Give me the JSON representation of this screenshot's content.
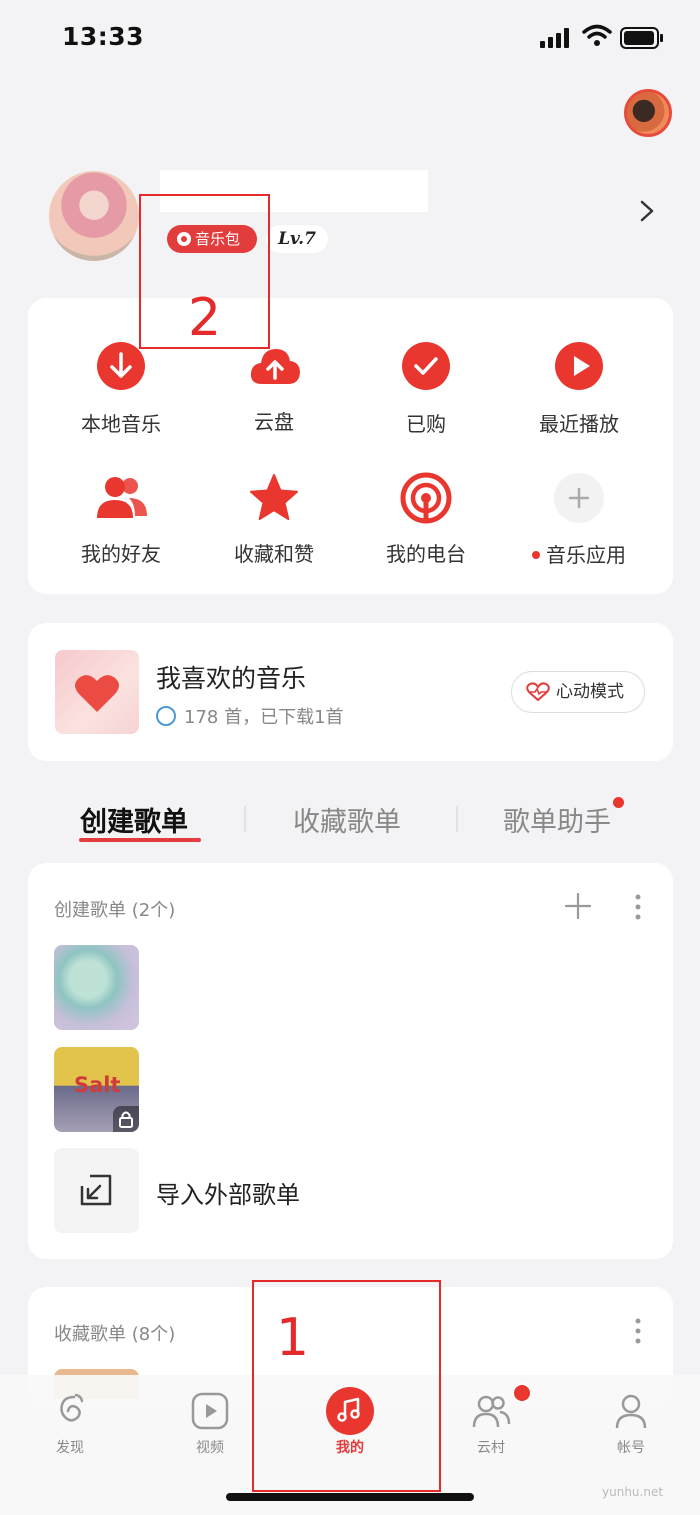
{
  "status_bar": {
    "time": "13:33"
  },
  "profile": {
    "badge_music": "音乐包",
    "level": "Lv.7"
  },
  "quick_grid": [
    {
      "label": "本地音乐",
      "icon": "download-icon"
    },
    {
      "label": "云盘",
      "icon": "cloud-upload-icon"
    },
    {
      "label": "已购",
      "icon": "check-icon"
    },
    {
      "label": "最近播放",
      "icon": "play-icon"
    },
    {
      "label": "我的好友",
      "icon": "friends-icon"
    },
    {
      "label": "收藏和赞",
      "icon": "star-icon"
    },
    {
      "label": "我的电台",
      "icon": "radio-icon"
    },
    {
      "label": "音乐应用",
      "icon": "plus-icon"
    }
  ],
  "favorites": {
    "title": "我喜欢的音乐",
    "subtitle": "178 首，已下载1首",
    "mode_button": "心动模式"
  },
  "tabs": [
    "创建歌单",
    "收藏歌单",
    "歌单助手"
  ],
  "created_playlists": {
    "header": "创建歌单 (2个)",
    "cover2_text": "Salt",
    "import_label": "导入外部歌单"
  },
  "collected_playlists": {
    "header": "收藏歌单 (8个)"
  },
  "tabbar": [
    {
      "label": "发现",
      "icon": "netease-logo-icon"
    },
    {
      "label": "视频",
      "icon": "video-play-icon"
    },
    {
      "label": "我的",
      "icon": "music-note-icon"
    },
    {
      "label": "云村",
      "icon": "community-icon"
    },
    {
      "label": "帐号",
      "icon": "account-icon"
    }
  ],
  "annotations": [
    "1",
    "2"
  ],
  "watermark": "yunhu.net",
  "colors": {
    "accent": "#e33c3c",
    "background": "#f3f3f5",
    "card": "#ffffff"
  }
}
